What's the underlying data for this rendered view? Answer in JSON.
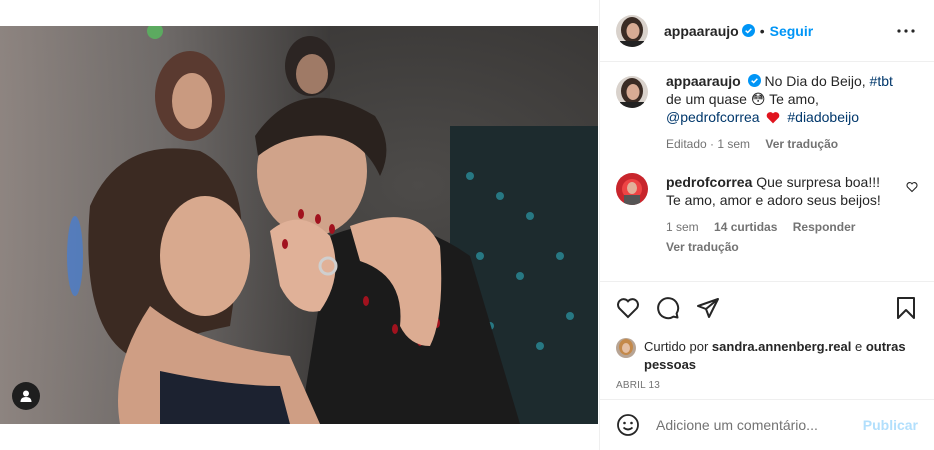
{
  "post": {
    "username": "appaaraujo",
    "follow_label": "Seguir",
    "dot": "•"
  },
  "caption": {
    "username": "appaaraujo",
    "text_1": "No Dia do Beijo, ",
    "hashtag_1": "#tbt",
    "text_2": " de um quase ",
    "emoji_1": "😳",
    "text_3": " Te amo, ",
    "mention": "@pedrofcorrea",
    "emoji_2": "❤️",
    "hashtag_2": "#diadobeijo",
    "edited": "Editado · 1 sem",
    "translate": "Ver tradução"
  },
  "comment": {
    "username": "pedrofcorrea",
    "text": "Que surpresa boa!!! Te amo, amor e adoro seus beijos!",
    "time": "1 sem",
    "likes": "14 curtidas",
    "reply": "Responder",
    "translate": "Ver tradução"
  },
  "likes": {
    "prefix": "Curtido por ",
    "user": "sandra.annenberg.real",
    "middle": " e ",
    "others": "outras pessoas"
  },
  "date": "ABRIL 13",
  "add_comment": {
    "placeholder": "Adicione um comentário...",
    "post_label": "Publicar"
  },
  "colors": {
    "accent": "#0095f6",
    "verified": "#0095f6",
    "heart": "#ed4956"
  }
}
